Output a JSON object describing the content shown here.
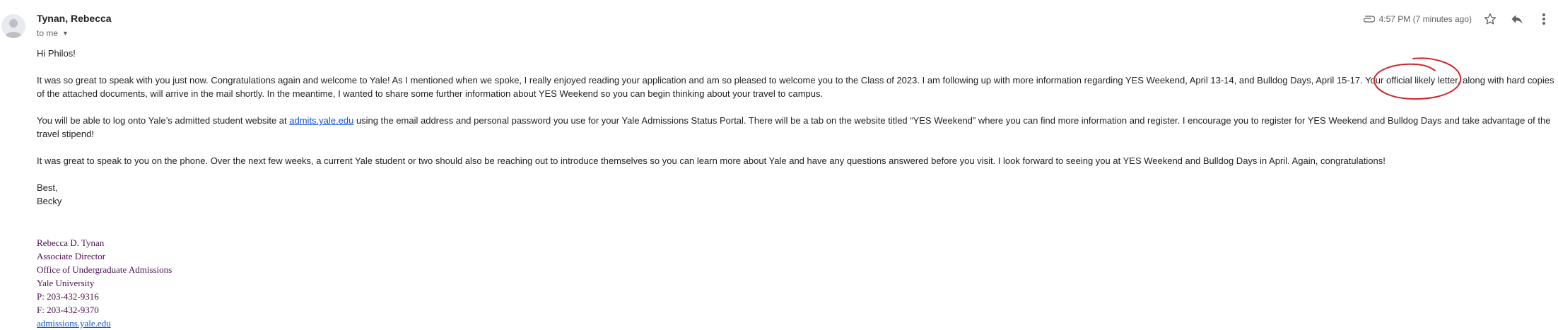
{
  "header": {
    "sender_name": "Tynan, Rebecca",
    "recipient_label": "to me",
    "timestamp": "4:57 PM (7 minutes ago)",
    "icons": [
      "avatar",
      "attachment-icon",
      "star-icon",
      "reply-icon",
      "more-vertical-icon"
    ]
  },
  "body": {
    "greeting": "Hi Philos!",
    "p1": "It was so great to speak with you just now. Congratulations again and welcome to Yale! As I mentioned when we spoke, I really enjoyed reading your application and am so pleased to welcome you to the Class of 2023. I am following up with more information regarding YES Weekend, April 13-14, and Bulldog Days, April 15-17. Your official likely letter, along with hard copies of the attached documents, will arrive in the mail shortly. In the meantime, I wanted to share some further information about YES Weekend so you can begin thinking about your travel to campus.",
    "p2_before": "You will be able to log onto Yale’s admitted student website at ",
    "p2_link": "admits.yale.edu",
    "p2_after": " using the email address and personal password you use for your Yale Admissions Status Portal. There will be a tab on the website titled “YES Weekend” where you can find more information and register. I encourage you to register for YES Weekend and Bulldog Days and take advantage of the travel stipend!",
    "p3": "It was great to speak to you on the phone. Over the next few weeks, a current Yale student or two should also be reaching out to introduce themselves so you can learn more about Yale and have any questions answered before you visit. I look forward to seeing you at YES Weekend and Bulldog Days in April. Again, congratulations!",
    "closing": "Best,",
    "short_name": "Becky"
  },
  "signature": {
    "name": "Rebecca D. Tynan",
    "title": "Associate Director",
    "office": "Office of Undergraduate Admissions",
    "university": "Yale University",
    "phone": "P: 203-432-9316",
    "fax": "F: 203-432-9370",
    "link": "admissions.yale.edu"
  },
  "colors": {
    "link": "#1155cc",
    "signature": "#4b0f50",
    "annotation": "#d0262a"
  }
}
